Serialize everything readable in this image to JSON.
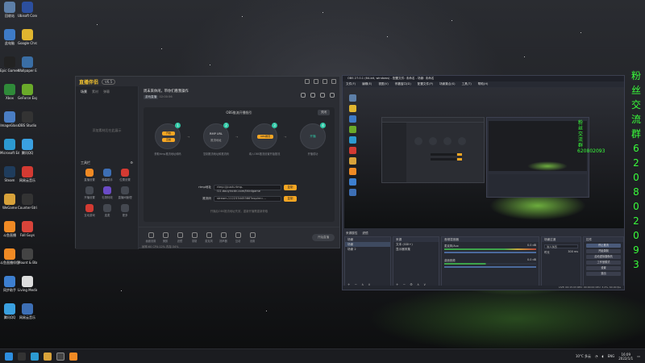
{
  "desktop": {
    "icons": [
      {
        "label": "回收站",
        "color": "#5d7fa8"
      },
      {
        "label": "Ubisoft Connect",
        "color": "#2c4f9e"
      },
      {
        "label": "此电脑",
        "color": "#3e7bc7"
      },
      {
        "label": "Google Chrome",
        "color": "#e0b52f"
      },
      {
        "label": "Epic Games Launcher",
        "color": "#222222"
      },
      {
        "label": "Wallpaper Engine",
        "color": "#3a6ea5"
      },
      {
        "label": "Xbox",
        "color": "#2f8a39"
      },
      {
        "label": "GeForce Experience",
        "color": "#6aaa2a"
      },
      {
        "label": "ImageGlass",
        "color": "#4a7ec4"
      },
      {
        "label": "OBS Studio",
        "color": "#333333"
      },
      {
        "label": "Microsoft Edge",
        "color": "#2c9ad1"
      },
      {
        "label": "腾讯QQ",
        "color": "#3aa0e0"
      },
      {
        "label": "Steam",
        "color": "#1f3c5c"
      },
      {
        "label": "网易云音乐",
        "color": "#d33a32"
      },
      {
        "label": "WeGame",
        "color": "#d8a23a"
      },
      {
        "label": "Counter-Strike",
        "color": "#333333"
      },
      {
        "label": "斗鱼直播",
        "color": "#f08a24"
      },
      {
        "label": "Fall Guys",
        "color": "#d8443a"
      },
      {
        "label": "斗鱼直播伴侣",
        "color": "#f08a24"
      },
      {
        "label": "Mount & Blade II",
        "color": "#444444"
      },
      {
        "label": "同步助手",
        "color": "#3d7fd0"
      },
      {
        "label": "Living Medieval",
        "color": "#dddddd"
      },
      {
        "label": "腾讯QQ",
        "color": "#3aa0e0"
      },
      {
        "label": "网易云音乐",
        "color": "#3d6fb5"
      }
    ],
    "side_text_chars": [
      "粉",
      "丝",
      "交",
      "流",
      "群",
      "6",
      "2",
      "0",
      "8",
      "0",
      "2",
      "0",
      "9",
      "3"
    ]
  },
  "live_app": {
    "logo": "直播伴侣",
    "version": "V6.5",
    "tabs": [
      "场景",
      "素材",
      "弹幕"
    ],
    "empty_hint": "添加素材后在此展示",
    "tools_title": "工具栏",
    "tools": [
      "直播设置",
      "弹幕助手",
      "位置设置",
      "开播设置",
      "礼物特效",
      "直播间管理",
      "互动游戏",
      "连麦",
      "更多"
    ],
    "stream_title": "周末来休闲，带你们看我操作",
    "stream_tag": "游戏直播",
    "stream_meta": "02:00:56",
    "panel_title": "OBS推流开播指引",
    "panel_close": "关闭",
    "steps": [
      {
        "num": "1",
        "label_a": "开始",
        "label_b": "直播",
        "caption": "获取rtmp推流地址和码"
      },
      {
        "num": "2",
        "label_a": "RMP URL",
        "label_b": "推流地址",
        "caption": "复制推流地址和推流码"
      },
      {
        "num": "3",
        "label_a": "OBS推流",
        "label_b": "",
        "caption": "填入OBS推流设置开始推流"
      },
      {
        "num": "4",
        "label_a": "开播",
        "label_b": "",
        "caption": "开播成功"
      }
    ],
    "fields": [
      {
        "label": "rtmp地址",
        "value": "rtmp://push-rtmp-l11.douyincdn.com/thirdgame",
        "button": "复制"
      },
      {
        "label": "推流码",
        "value": "stream-112233445566?expire=...",
        "button": "复制"
      }
    ],
    "panel_foot": "开播后OBS推流地址失效，重新开播需重新获取",
    "bottom_items": [
      "画面设置",
      "美颜",
      "滤镜",
      "录制",
      "麦克风",
      "扬声器",
      "互动",
      "设置"
    ],
    "start_button": "开始直播",
    "status_text": "帧率:60 CPU:12% 内存:34%"
  },
  "obs": {
    "title": "OBS 27.0.1 (64-bit, windows) - 配置文件: 未命名 - 场景: 未命名",
    "menu": [
      "文件(F)",
      "编辑(E)",
      "视图(V)",
      "停靠窗口(D)",
      "配置文件(P)",
      "场景集合(S)",
      "工具(T)",
      "帮助(H)"
    ],
    "dock_tabs": [
      "来源属性",
      "滤镜"
    ],
    "docks": {
      "scenes": {
        "title": "场景",
        "items": [
          "场景",
          "场景 2"
        ]
      },
      "sources": {
        "title": "来源",
        "items": [
          "文本 (GDI+)",
          "显示器采集"
        ]
      },
      "mixer": {
        "title": "音频混音器",
        "channels": [
          {
            "name": "麦克风/Aux",
            "level": "0.0 dB"
          },
          {
            "name": "桌面音频",
            "level": "0.0 dB"
          }
        ]
      },
      "transitions": {
        "title": "场景过渡",
        "type": "淡入淡出",
        "duration_label": "时长",
        "duration": "300 ms"
      },
      "controls": {
        "title": "控件",
        "buttons": [
          "停止推流",
          "开始录制",
          "启动虚拟摄像机",
          "工作室模式",
          "设置",
          "退出"
        ]
      }
    },
    "status": "LIVE: 00:15:03   REC: 00:00:00   CPU: 3.2%, 60.00 fps"
  },
  "taskbar": {
    "tray_text": "10°C 多云",
    "lang": "ENG",
    "time": "16:09",
    "date": "2022/1/1"
  },
  "colors": {
    "accent": "#f5a623",
    "teal": "#2fc7a5",
    "neon_green": "#39ff3b"
  }
}
